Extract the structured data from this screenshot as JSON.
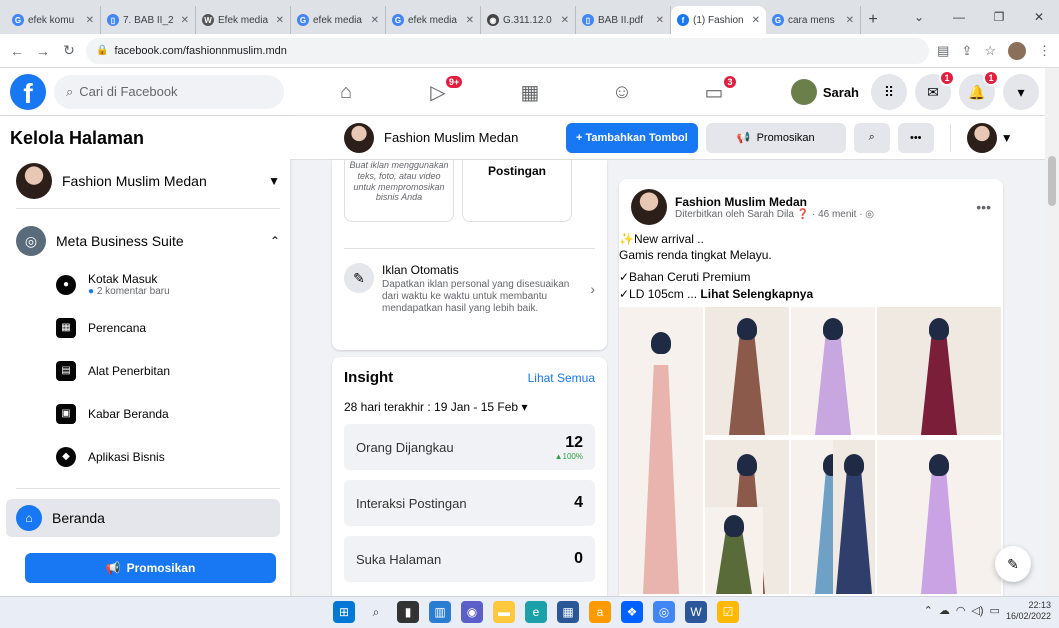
{
  "browser": {
    "tabs": [
      {
        "label": "efek komu",
        "favicon": "G",
        "color": "#4285f4"
      },
      {
        "label": "7. BAB II_2",
        "favicon": "▯",
        "color": "#4285f4"
      },
      {
        "label": "Efek media",
        "favicon": "W",
        "color": "#555555"
      },
      {
        "label": "efek media",
        "favicon": "G",
        "color": "#4285f4"
      },
      {
        "label": "efek media",
        "favicon": "G",
        "color": "#4285f4"
      },
      {
        "label": "G.311.12.0",
        "favicon": "◉",
        "color": "#444444"
      },
      {
        "label": "BAB II.pdf",
        "favicon": "▯",
        "color": "#4285f4"
      },
      {
        "label": "(1) Fashion",
        "favicon": "f",
        "color": "#1877f2"
      },
      {
        "label": "cara mens",
        "favicon": "G",
        "color": "#4285f4"
      }
    ],
    "url": "facebook.com/fashionnmuslim.mdn"
  },
  "fbnav": {
    "search_placeholder": "Cari di Facebook",
    "watch_badge": "9+",
    "pages_badge": "3",
    "profile_name": "Sarah",
    "messenger_badge": "1",
    "notif_badge": "1"
  },
  "sidebar": {
    "title": "Kelola Halaman",
    "page_name": "Fashion Muslim Medan",
    "mbs_label": "Meta Business Suite",
    "items": [
      {
        "label": "Kotak Masuk",
        "sub": "2 komentar baru"
      },
      {
        "label": "Perencana"
      },
      {
        "label": "Alat Penerbitan"
      },
      {
        "label": "Kabar Beranda"
      },
      {
        "label": "Aplikasi Bisnis"
      }
    ],
    "home_label": "Beranda",
    "promote_label": "Promosikan"
  },
  "pagebar": {
    "title": "Fashion Muslim Medan",
    "add_button": "+ Tambahkan Tombol",
    "promote": "Promosikan"
  },
  "promo_card": {
    "box1": "Buat iklan menggunakan teks, foto, atau video untuk mempromosikan bisnis Anda",
    "box2": "Postingan",
    "auto_ads_title": "Iklan Otomatis",
    "auto_ads_desc": "Dapatkan iklan personal yang disesuaikan dari waktu ke waktu untuk membantu mendapatkan hasil yang lebih baik."
  },
  "insight": {
    "title": "Insight",
    "see_all": "Lihat Semua",
    "range": "28 hari terakhir : 19 Jan - 15 Feb",
    "rows": [
      {
        "label": "Orang Dijangkau",
        "value": "12",
        "change": "▲100%"
      },
      {
        "label": "Interaksi Postingan",
        "value": "4",
        "change": ""
      },
      {
        "label": "Suka Halaman",
        "value": "0",
        "change": ""
      }
    ]
  },
  "post": {
    "page_name": "Fashion Muslim Medan",
    "meta": "Diterbitkan oleh Sarah Dila ❓ · 46 menit · ◎",
    "line1": "New arrival ..",
    "line2": "Gamis renda tingkat Melayu.",
    "line3": "✓Bahan Ceruti Premium",
    "line4": "✓LD 105cm ... ",
    "see_more": "Lihat Selengkapnya"
  },
  "taskbar": {
    "time": "22:13",
    "date": "16/02/2022"
  },
  "colors": {
    "fb_blue": "#1877f2",
    "badge_red": "#e41e3f",
    "dress_colors": [
      "#e8b4ad",
      "#8b5a4a",
      "#c8a6e0",
      "#7a1e3a",
      "#c9a3e3",
      "#8b5a4a",
      "#6fa0c6",
      "#2f3e6b",
      "#5a6b3a"
    ]
  }
}
